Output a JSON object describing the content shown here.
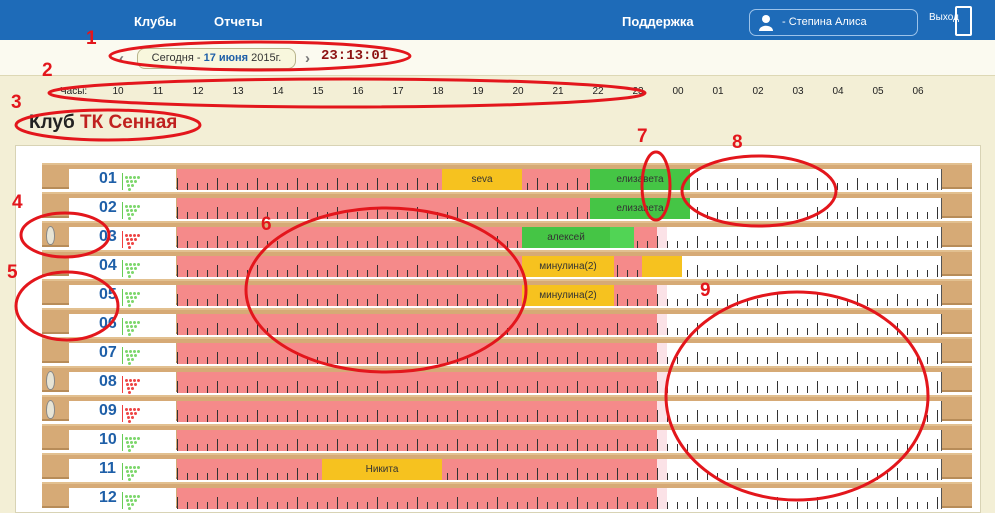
{
  "nav": {
    "clubs": "Клубы",
    "reports": "Отчеты",
    "support": "Поддержка",
    "user": "- Степина Алиса Игоревна",
    "logout": "Выход"
  },
  "datebar": {
    "prefix": "Сегодня - ",
    "date_bold": "17 июня",
    "year": " 2015г.",
    "time": "23:13:01"
  },
  "hours": {
    "label": "Часы:",
    "values": [
      "10",
      "11",
      "12",
      "13",
      "14",
      "15",
      "16",
      "17",
      "18",
      "19",
      "20",
      "21",
      "22",
      "23",
      "00",
      "01",
      "02",
      "03",
      "04",
      "05",
      "06"
    ]
  },
  "club": {
    "prefix": "Клуб",
    "name": "ТК Сенная"
  },
  "annotations": [
    "1",
    "2",
    "3",
    "4",
    "5",
    "6",
    "7",
    "8",
    "9"
  ],
  "lanes": [
    {
      "number": "01",
      "ball": false,
      "pins": "green",
      "bookings": [
        {
          "name": "seva",
          "start": 17,
          "end": 19,
          "color": "yellow"
        },
        {
          "name": "елизавета",
          "start": 20.7,
          "end": 23.2,
          "color": "green"
        }
      ]
    },
    {
      "number": "02",
      "ball": false,
      "pins": "green",
      "bookings": [
        {
          "name": "елизавета",
          "start": 20.7,
          "end": 23.2,
          "color": "green"
        }
      ]
    },
    {
      "number": "03",
      "ball": true,
      "pins": "red",
      "bookings": [
        {
          "name": "алексей",
          "start": 19,
          "end": 21.2,
          "color": "green"
        },
        {
          "name": "",
          "start": 21.2,
          "end": 21.8,
          "color": "lgreen"
        }
      ]
    },
    {
      "number": "04",
      "ball": false,
      "pins": "green",
      "bookings": [
        {
          "name": "минулина(2)",
          "start": 19,
          "end": 21.3,
          "color": "yellow"
        },
        {
          "name": "",
          "start": 22,
          "end": 23,
          "color": "yellow"
        }
      ]
    },
    {
      "number": "05",
      "ball": false,
      "pins": "green",
      "bookings": [
        {
          "name": "минулина(2)",
          "start": 19,
          "end": 21.3,
          "color": "yellow"
        }
      ]
    },
    {
      "number": "06",
      "ball": false,
      "pins": "green",
      "bookings": []
    },
    {
      "number": "07",
      "ball": false,
      "pins": "green",
      "bookings": []
    },
    {
      "number": "08",
      "ball": true,
      "pins": "red",
      "bookings": []
    },
    {
      "number": "09",
      "ball": true,
      "pins": "red",
      "bookings": []
    },
    {
      "number": "10",
      "ball": false,
      "pins": "green",
      "bookings": []
    },
    {
      "number": "11",
      "ball": false,
      "pins": "green",
      "bookings": [
        {
          "name": "Никита",
          "start": 14,
          "end": 17,
          "color": "yellow"
        }
      ]
    },
    {
      "number": "12",
      "ball": false,
      "pins": "green",
      "bookings": []
    }
  ],
  "colors": {
    "topbar": "#1e6bb8",
    "past_slot": "#f58a8a",
    "current_slot": "#fbe2e7",
    "booking_yellow": "#f6c21f",
    "booking_green": "#45c545",
    "annotation": "#e3161c"
  }
}
